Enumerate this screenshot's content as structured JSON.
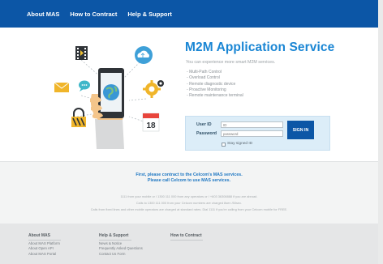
{
  "nav": {
    "items": [
      "About MAS",
      "How to Contract",
      "Help & Support"
    ]
  },
  "hero": {
    "title": "M2M Application Service",
    "subtitle": "You can experience more smart M2M services.",
    "features": [
      "Multi-Path Control",
      "Overload Control",
      "Remote diagnostic device",
      "Proactive Monitoring",
      "Remote maintenance terminal"
    ],
    "calendar_number": "18"
  },
  "login": {
    "userid_label": "User ID",
    "userid_placeholder": "ID",
    "password_label": "Password",
    "password_placeholder": "password",
    "signin_label": "SIGN IN",
    "stay_label": "Stay signed ID"
  },
  "info": {
    "notice_1": "First, please contract to the Celcom's MAS services.",
    "notice_2": "Please call Celcom to use MAS services.",
    "small": [
      "1111 from your mobile or / 1300 111 000 from any operators or / +603 36308888 if you are abroad.",
      "Calls to 1300 111 000 from your Celcom numbers are charged 8sen /50sec.",
      "Calls from fixed lines and other mobile operators are charged at standard rates. Dial 1111 if you're calling from your Celcom mobile for FREE."
    ]
  },
  "footer": {
    "columns": [
      {
        "title": "About MAS",
        "links": [
          "About MAS Platform",
          "About Open API",
          "About MAS Portal"
        ]
      },
      {
        "title": "Help & Support",
        "links": [
          "News & Notice",
          "Frequently Asked Questions",
          "Contact Us Form"
        ]
      },
      {
        "title": "How to Contract",
        "links": []
      }
    ]
  },
  "colors": {
    "brand_blue": "#0c56a6",
    "title_blue": "#1a86d4",
    "login_panel": "#dcedf8"
  }
}
